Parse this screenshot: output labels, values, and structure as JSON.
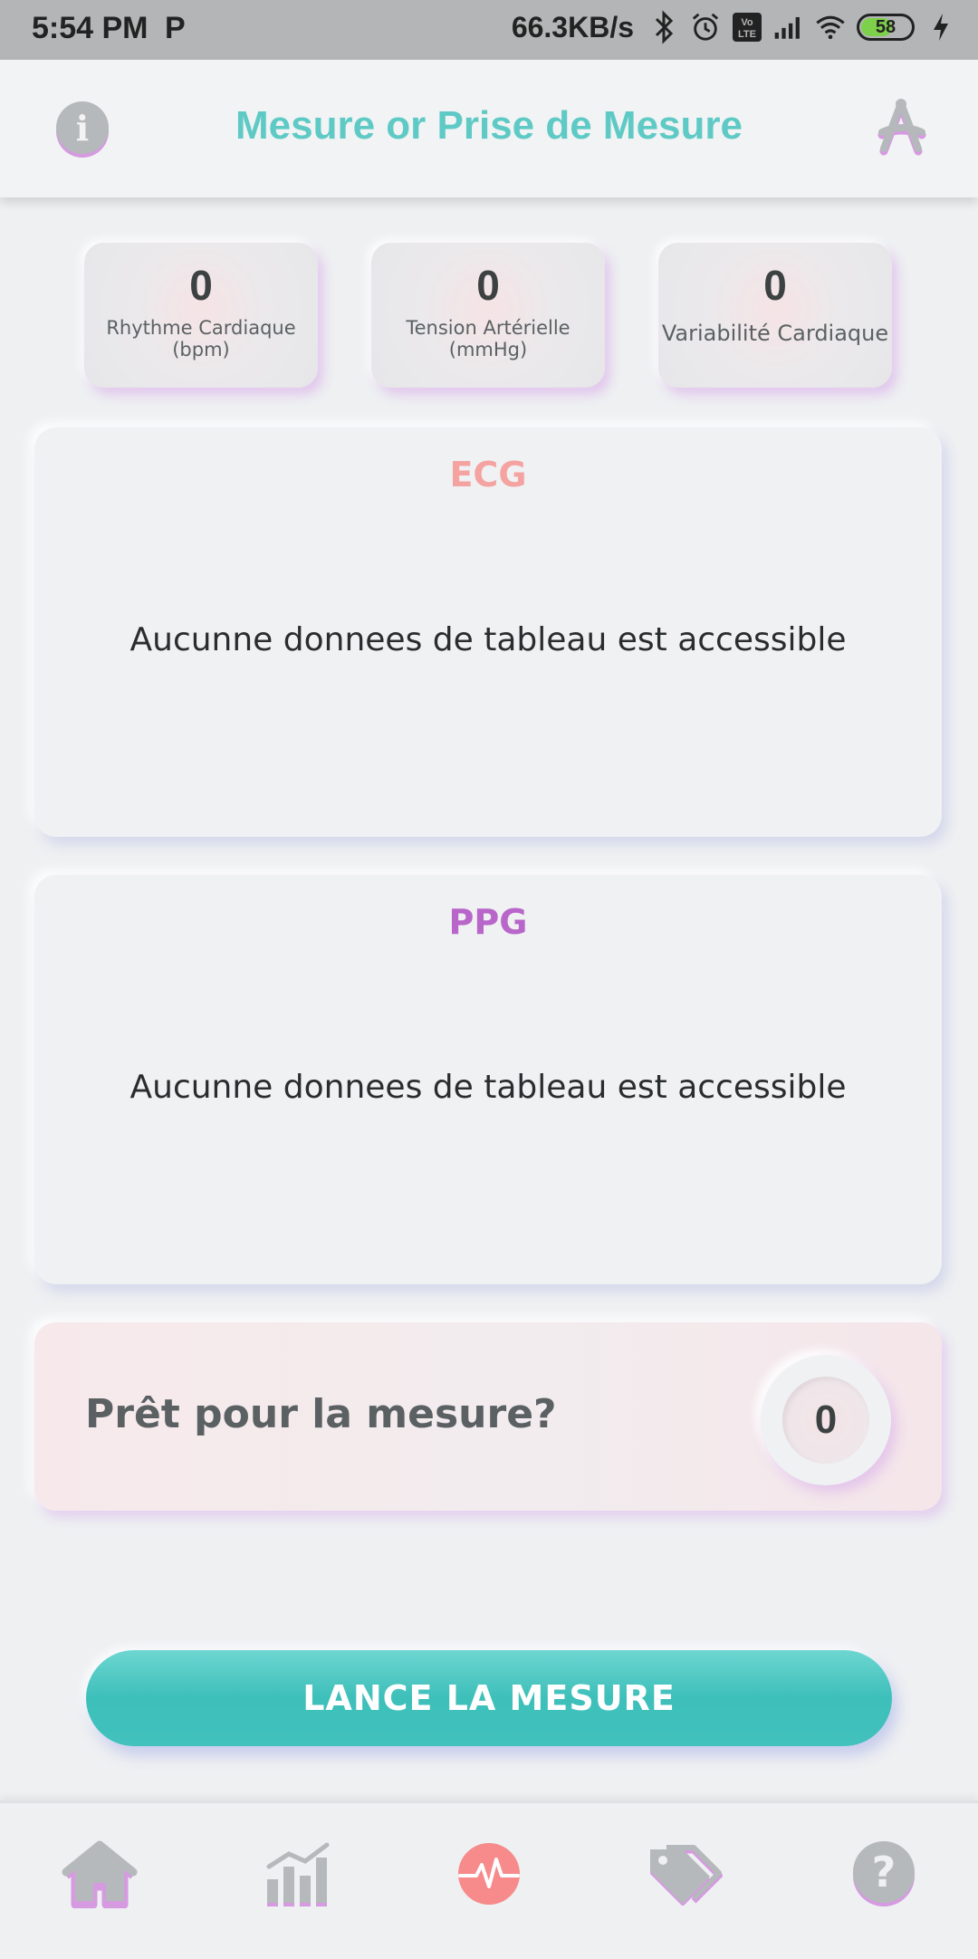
{
  "status_bar": {
    "time": "5:54 PM",
    "p_indicator": "P",
    "net_speed": "66.3KB/s",
    "volte": "Vo LTE",
    "battery_level": "58",
    "icons": [
      "p-icon",
      "bluetooth-icon",
      "alarm-icon",
      "volte-icon",
      "signal-icon",
      "wifi-icon",
      "battery-icon",
      "charging-icon"
    ]
  },
  "app_bar": {
    "title": "Mesure or Prise de Mesure",
    "info_label": "i",
    "left_icon": "info-icon",
    "right_icon": "tools-icon"
  },
  "metrics": [
    {
      "value": "0",
      "label": "Rhythme Cardiaque (bpm)"
    },
    {
      "value": "0",
      "label": "Tension Artérielle (mmHg)"
    },
    {
      "value": "0",
      "label": "Variabilité Cardiaque"
    }
  ],
  "charts": [
    {
      "title": "ECG",
      "title_color": "#f4a3a1",
      "empty_message": "Aucunne donnees de tableau est accessible"
    },
    {
      "title": "PPG",
      "title_color": "#b866c9",
      "empty_message": "Aucunne donnees de tableau est accessible"
    }
  ],
  "ready": {
    "text": "Prêt pour la mesure?",
    "count": "0"
  },
  "launch_button": {
    "label": "LANCE LA MESURE"
  },
  "bottom_nav": {
    "items": [
      {
        "name": "home",
        "icon": "home-icon",
        "active": false
      },
      {
        "name": "stats",
        "icon": "chart-icon",
        "active": false
      },
      {
        "name": "measure",
        "icon": "heartbeat-icon",
        "active": true
      },
      {
        "name": "tags",
        "icon": "tags-icon",
        "active": false
      },
      {
        "name": "help",
        "icon": "help-icon",
        "active": false
      }
    ]
  },
  "colors": {
    "accent": "#5fcac5",
    "button": "#42c1bd",
    "active_nav": "#f78a8a",
    "icon_gray": "#b5b9bb",
    "icon_shadow": "#d59ae0"
  }
}
